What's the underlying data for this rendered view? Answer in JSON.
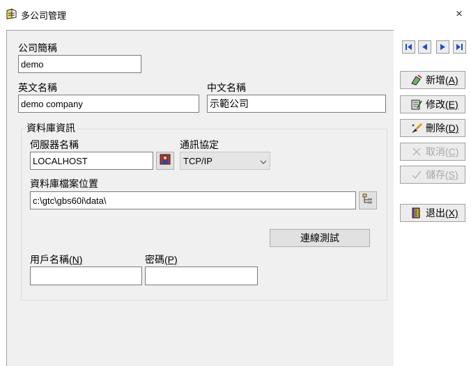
{
  "window": {
    "title": "多公司管理",
    "close_glyph": "×"
  },
  "form": {
    "company_short_label": "公司簡稱",
    "company_short_value": "demo",
    "english_name_label": "英文名稱",
    "english_name_value": "demo company",
    "chinese_name_label": "中文名稱",
    "chinese_name_value": "示範公司",
    "db_group_label": "資料庫資訊",
    "server_label": "伺服器名稱",
    "server_value": "LOCALHOST",
    "protocol_label": "通訊協定",
    "protocol_value": "TCP/IP",
    "db_path_label": "資料庫檔案位置",
    "db_path_value": "c:\\gtc\\gbs60i\\data\\",
    "test_button": "連線測試",
    "username_label": "用戶名稱",
    "username_hotkey": "(N)",
    "username_value": "",
    "password_label": "密碼",
    "password_hotkey": "(P)",
    "password_value": ""
  },
  "nav": {
    "icons": [
      "first-record-icon",
      "prev-record-icon",
      "next-record-icon",
      "last-record-icon"
    ]
  },
  "side_buttons": {
    "add": {
      "label": "新增",
      "hotkey": "(A)"
    },
    "edit": {
      "label": "修改",
      "hotkey": "(E)"
    },
    "delete": {
      "label": "刪除",
      "hotkey": "(D)"
    },
    "cancel": {
      "label": "取消",
      "hotkey": "(C)"
    },
    "save": {
      "label": "儲存",
      "hotkey": "(S)"
    },
    "exit": {
      "label": "退出",
      "hotkey": "(X)"
    }
  },
  "colors": {
    "nav_arrow": "#1f4fc4",
    "disabled_text": "#a8a8a8",
    "panel_bg": "#f0f0f0"
  }
}
